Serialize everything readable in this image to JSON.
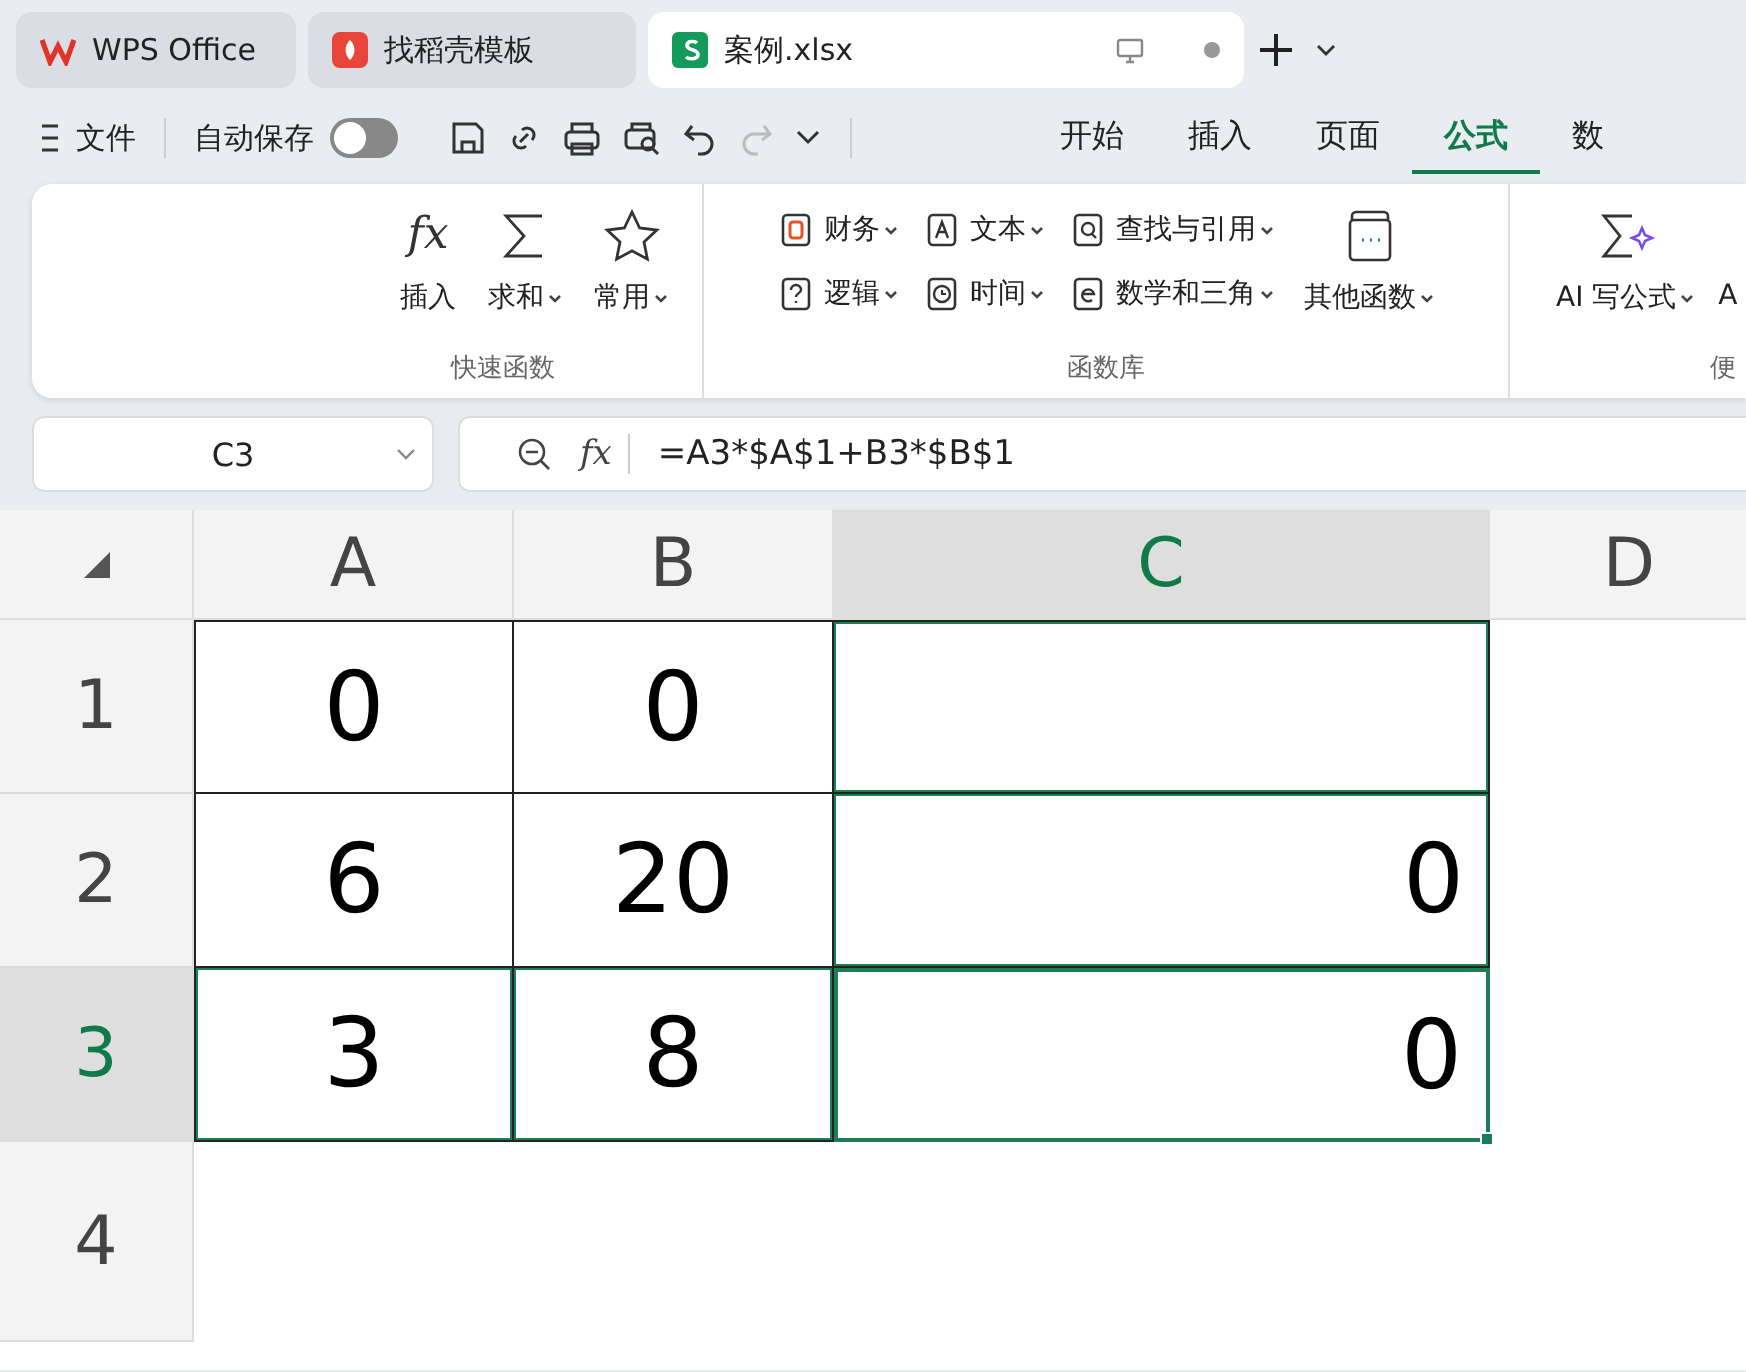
{
  "tabs": [
    {
      "label": "WPS Office",
      "kind": "home",
      "selected": false
    },
    {
      "label": "找稻壳模板",
      "kind": "template",
      "selected": false
    },
    {
      "label": "案例.xlsx",
      "kind": "sheet",
      "selected": true
    }
  ],
  "toolbar": {
    "file_label": "文件",
    "autosave_label": "自动保存",
    "autosave_on": false
  },
  "menu_tabs": [
    {
      "label": "开始",
      "selected": false
    },
    {
      "label": "插入",
      "selected": false
    },
    {
      "label": "页面",
      "selected": false
    },
    {
      "label": "公式",
      "selected": true
    },
    {
      "label": "数",
      "selected": false
    }
  ],
  "ribbon": {
    "quick_group": {
      "title": "快速函数",
      "items": [
        {
          "label": "插入",
          "kind": "fx",
          "icon_text": "fx",
          "dropdown": false
        },
        {
          "label": "求和",
          "kind": "sigma",
          "dropdown": true
        },
        {
          "label": "常用",
          "kind": "star",
          "dropdown": true
        }
      ]
    },
    "library_group": {
      "title": "函数库",
      "rows": [
        [
          {
            "label": "财务",
            "kind": "finance"
          },
          {
            "label": "文本",
            "kind": "text"
          },
          {
            "label": "查找与引用",
            "kind": "lookup"
          }
        ],
        [
          {
            "label": "逻辑",
            "kind": "logic"
          },
          {
            "label": "时间",
            "kind": "time"
          },
          {
            "label": "数学和三角",
            "kind": "math"
          }
        ]
      ],
      "other": {
        "label": "其他函数"
      }
    },
    "ai_group": {
      "title": "便",
      "items": [
        {
          "label": "AI 写公式"
        },
        {
          "label": "A"
        }
      ]
    }
  },
  "formula_bar": {
    "cell_ref": "C3",
    "fx_label": "fx",
    "formula": "=A3*$A$1+B3*$B$1"
  },
  "grid": {
    "columns": [
      {
        "label": "A",
        "selected": false
      },
      {
        "label": "B",
        "selected": false
      },
      {
        "label": "C",
        "selected": true
      },
      {
        "label": "D",
        "selected": false
      }
    ],
    "rows": [
      {
        "label": "1",
        "selected": false,
        "cells": [
          "0",
          "0",
          ""
        ]
      },
      {
        "label": "2",
        "selected": false,
        "cells": [
          "6",
          "20",
          "0"
        ]
      },
      {
        "label": "3",
        "selected": true,
        "cells": [
          "3",
          "8",
          "0"
        ]
      },
      {
        "label": "4",
        "selected": false,
        "cells": [
          "",
          "",
          ""
        ]
      }
    ]
  }
}
